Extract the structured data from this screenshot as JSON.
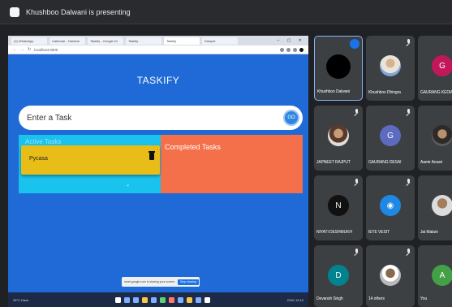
{
  "meeting": {
    "presenting_text": "Khushboo Dalwani is presenting"
  },
  "browser": {
    "tabs": [
      "(2) WhatsApp",
      "Calendar - Harshal",
      "Taskify - Google Dr",
      "Taskify",
      "Taskify",
      "Sample"
    ],
    "url": "localhost:3000"
  },
  "app": {
    "title": "TASKIFY",
    "input_placeholder": "Enter a Task",
    "go_label": "GO",
    "active_label": "Active Tasks",
    "completed_label": "Completed Tasks",
    "dragging_task": "Pycasa"
  },
  "share_notice": {
    "text": "meet.google.com is sharing your screen.",
    "stop": "Stop sharing",
    "hide": "Hide"
  },
  "taskbar": {
    "weather": "28°C Haze",
    "tray": "ENG 12:10"
  },
  "participants": [
    {
      "name": "Khushboo Dalwani",
      "avatar": "black",
      "letter": "",
      "color": "#000000"
    },
    {
      "name": "Khushboo Dhingra",
      "avatar": "photo2",
      "letter": "",
      "color": ""
    },
    {
      "name": "GAURANG KEDIA",
      "avatar": "letter",
      "letter": "G",
      "color": "#c2185b"
    },
    {
      "name": "JAPNEET RAJPUT",
      "avatar": "photo",
      "letter": "",
      "color": ""
    },
    {
      "name": "GAURANG DESAI",
      "avatar": "letter",
      "letter": "G",
      "color": "#5c6bc0"
    },
    {
      "name": "Aamir Ansari",
      "avatar": "photo3",
      "letter": "",
      "color": ""
    },
    {
      "name": "NIYATI DESHMUKH",
      "avatar": "letter",
      "letter": "N",
      "color": "#111111"
    },
    {
      "name": "IETE VESIT",
      "avatar": "letter",
      "letter": "◉",
      "color": "#1e88e5"
    },
    {
      "name": "Jai Malani",
      "avatar": "photo4",
      "letter": "",
      "color": ""
    },
    {
      "name": "Devansh Singh",
      "avatar": "letter",
      "letter": "D",
      "color": "#00838f"
    },
    {
      "name": "14 others",
      "avatar": "photo5",
      "letter": "",
      "color": ""
    },
    {
      "name": "You",
      "avatar": "letter",
      "letter": "A",
      "color": "#43a047"
    }
  ]
}
